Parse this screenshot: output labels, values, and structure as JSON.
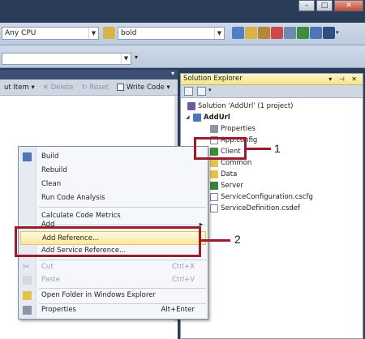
{
  "toolbar": {
    "platform": "Any CPU",
    "find_value": "bold"
  },
  "left_toolbar": {
    "items": [
      {
        "label": "ut Item",
        "arrow": "▾",
        "disabled": false
      },
      {
        "label": "Delete",
        "icon": "✕",
        "disabled": true
      },
      {
        "label": "Reset",
        "icon": "↻",
        "disabled": true
      },
      {
        "label": "Write Code",
        "arrow": "▾",
        "disabled": false
      }
    ]
  },
  "solution_explorer": {
    "title": "Solution Explorer",
    "title_buttons": "▾ ⊣ ✕",
    "tree": [
      {
        "label": "Solution 'AddUrl' (1 project)",
        "icon": "solution-icon"
      },
      {
        "label": "AddUrl",
        "icon": "cloud-project-icon",
        "bold": true
      },
      {
        "label": "Properties",
        "icon": "wrench-icon"
      },
      {
        "label": "App.config",
        "icon": "file-icon"
      },
      {
        "label": "Client",
        "icon": "web-role-icon"
      },
      {
        "label": "Common",
        "icon": "folder-icon"
      },
      {
        "label": "Data",
        "icon": "folder-icon"
      },
      {
        "label": "Server",
        "icon": "csharp-project-icon"
      },
      {
        "label": "ServiceConfiguration.cscfg",
        "icon": "file-icon"
      },
      {
        "label": "ServiceDefinition.csdef",
        "icon": "file-icon"
      }
    ]
  },
  "context_menu": {
    "items": [
      {
        "label": "Build",
        "icon": "build-icon"
      },
      {
        "label": "Rebuild"
      },
      {
        "label": "Clean"
      },
      {
        "label": "Run Code Analysis"
      },
      {
        "label": "Calculate Code Metrics"
      },
      {
        "label": "Add",
        "submenu": "▸"
      },
      {
        "label": "Add Reference..."
      },
      {
        "label": "Add Service Reference..."
      },
      {
        "label": "Cut",
        "shortcut": "Ctrl+X",
        "disabled": true,
        "icon": "scissors-icon"
      },
      {
        "label": "Paste",
        "shortcut": "Ctrl+V",
        "disabled": true,
        "icon": "paste-icon"
      },
      {
        "label": "Open Folder in Windows Explorer",
        "icon": "open-folder-icon"
      },
      {
        "label": "Properties",
        "shortcut": "Alt+Enter",
        "icon": "properties-icon"
      }
    ]
  },
  "annotations": {
    "one": "1",
    "two": "2"
  },
  "colors": {
    "callout": "#9b1c2c",
    "highlight": "#fde59b",
    "chrome": "#2b3c59"
  }
}
